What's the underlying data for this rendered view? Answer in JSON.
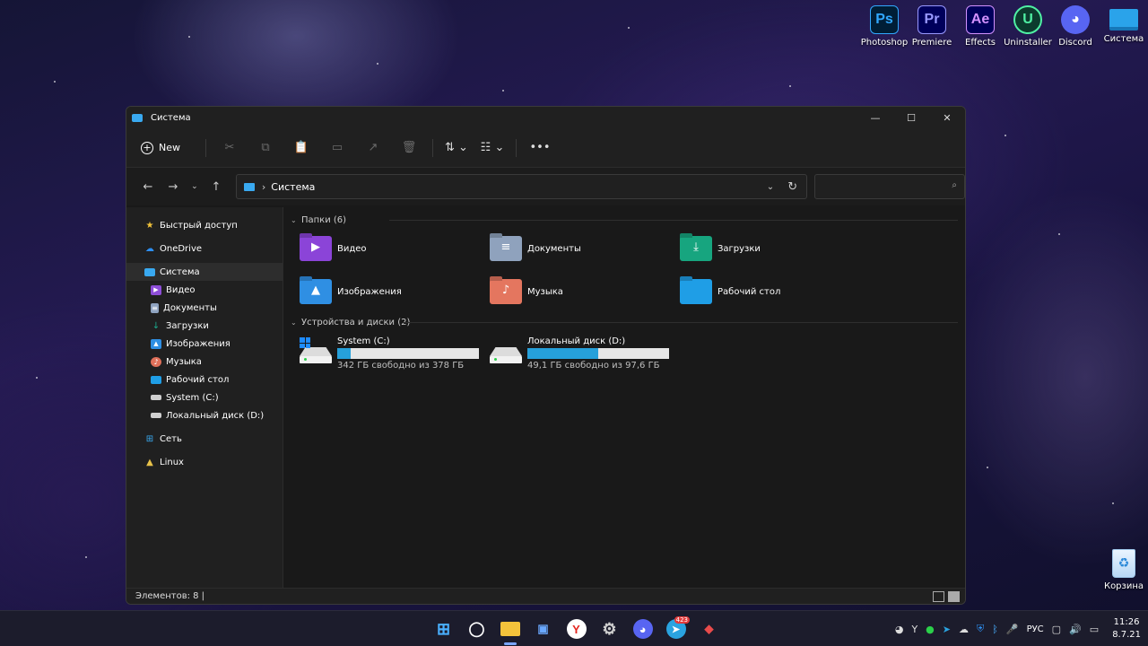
{
  "desktop": {
    "icons": [
      {
        "label": "Photoshop",
        "glyph": "Ps",
        "bg": "#001e36",
        "fg": "#31a8ff"
      },
      {
        "label": "Premiere",
        "glyph": "Pr",
        "bg": "#00005b",
        "fg": "#9999ff"
      },
      {
        "label": "Effects",
        "glyph": "Ae",
        "bg": "#00005b",
        "fg": "#d291ff"
      },
      {
        "label": "Uninstaller",
        "glyph": "U",
        "bg": "#0c3b2e",
        "fg": "#4ff0a4"
      },
      {
        "label": "Discord",
        "glyph": "◕",
        "bg": "#5865f2",
        "fg": "#ffffff"
      },
      {
        "label": "Система",
        "glyph": "",
        "bg": "#2aa3ea",
        "fg": "#ffffff"
      }
    ],
    "recycle_bin": "Корзина"
  },
  "window": {
    "title": "Система",
    "controls": {
      "minimize": "—",
      "maximize": "☐",
      "close": "✕"
    },
    "toolbar": {
      "new_label": "New",
      "new_icon": "+",
      "cut": "✂",
      "copy": "⧉",
      "paste": "📋",
      "rename": "▭",
      "share": "↗",
      "delete": "🗑",
      "sort": "⇅ ⌄",
      "view": "☷ ⌄",
      "more": "•••"
    },
    "nav_buttons": {
      "back": "←",
      "forward": "→",
      "recent": "⌄",
      "up": "↑"
    },
    "address": {
      "path": "Система",
      "chevron": "›",
      "dropdown": "⌄",
      "refresh": "↻"
    },
    "search": {
      "placeholder": "",
      "icon": "⌕"
    },
    "sidebar": {
      "items": [
        {
          "label": "Быстрый доступ",
          "icon": "★",
          "color": "#f3c43a"
        },
        {
          "label": "OneDrive",
          "icon": "☁",
          "color": "#2d8ef0"
        },
        {
          "label": "Система",
          "icon": "",
          "color": "#39a9f0"
        },
        {
          "label": "Видео",
          "icon": "▶",
          "color": "#8e4ed8"
        },
        {
          "label": "Документы",
          "icon": "≡",
          "color": "#8fa3c0"
        },
        {
          "label": "Загрузки",
          "icon": "↓",
          "color": "#1ca88b"
        },
        {
          "label": "Изображения",
          "icon": "▲",
          "color": "#2f8fe3"
        },
        {
          "label": "Музыка",
          "icon": "♪",
          "color": "#e0705a"
        },
        {
          "label": "Рабочий стол",
          "icon": "",
          "color": "#1f9ee6"
        },
        {
          "label": "System (C:)",
          "icon": "",
          "color": "#cfcfcf"
        },
        {
          "label": "Локальный диск (D:)",
          "icon": "",
          "color": "#cfcfcf"
        },
        {
          "label": "Сеть",
          "icon": "⊞",
          "color": "#39a9f0"
        },
        {
          "label": "Linux",
          "icon": "▲",
          "color": "#e8c24a"
        }
      ]
    },
    "folders_header": "Папки (6)",
    "folders": [
      {
        "label": "Видео",
        "icon": "▶",
        "color": "#8b44d8"
      },
      {
        "label": "Документы",
        "icon": "≡",
        "color": "#8fa2bd"
      },
      {
        "label": "Загрузки",
        "icon": "⤓",
        "color": "#17a57f"
      },
      {
        "label": "Изображения",
        "icon": "▲",
        "color": "#2f8fe3"
      },
      {
        "label": "Музыка",
        "icon": "♪",
        "color": "#e4765f"
      },
      {
        "label": "Рабочий стол",
        "icon": "",
        "color": "#1f9ee6"
      }
    ],
    "drives_header": "Устройства и диски (2)",
    "drives": [
      {
        "label": "System (C:)",
        "free": "342 ГБ свободно из 378 ГБ",
        "used_fraction": 0.095
      },
      {
        "label": "Локальный диск (D:)",
        "free": "49,1 ГБ свободно из 97,6 ГБ",
        "used_fraction": 0.497
      }
    ],
    "status": "Элементов: 8   |"
  },
  "taskbar": {
    "apps": [
      {
        "name": "Пуск",
        "glyph": "⊞",
        "bg": "transparent",
        "fg": "#4ab0ff"
      },
      {
        "name": "Поиск",
        "glyph": "◯",
        "bg": "transparent",
        "fg": "#ffffff"
      },
      {
        "name": "Проводник",
        "glyph": "▬",
        "bg": "#f3c23b",
        "fg": "#f3c23b",
        "active": true
      },
      {
        "name": "Диспетчер",
        "glyph": "▣",
        "bg": "transparent",
        "fg": "#6aa8ff"
      },
      {
        "name": "Яндекс",
        "glyph": "Y",
        "bg": "#ffffff",
        "fg": "#e52620"
      },
      {
        "name": "Параметры",
        "glyph": "⚙",
        "bg": "transparent",
        "fg": "#cfcfcf"
      },
      {
        "name": "Discord",
        "glyph": "◕",
        "bg": "#5865f2",
        "fg": "#ffffff"
      },
      {
        "name": "Telegram",
        "glyph": "➤",
        "bg": "#2aa3e0",
        "fg": "#ffffff",
        "badge": "423"
      },
      {
        "name": "Антивирус",
        "glyph": "◆",
        "bg": "transparent",
        "fg": "#e94b4b"
      }
    ],
    "tray_language": "РУС",
    "time": "11:26",
    "date": "8.7.21"
  }
}
